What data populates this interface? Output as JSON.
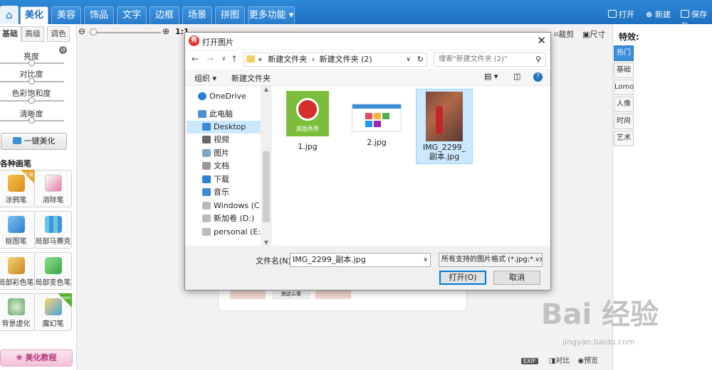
{
  "nav": {
    "home_icon": "home-icon",
    "tabs": [
      "美化",
      "美容",
      "饰品",
      "文字",
      "边框",
      "场景",
      "拼图",
      "更多功能"
    ],
    "right": {
      "open": "打开",
      "new": "新建",
      "save": "保存与"
    }
  },
  "left": {
    "tabs": [
      "基础",
      "高级",
      "调色"
    ],
    "sliders": [
      {
        "label": "亮度",
        "value": 0.5
      },
      {
        "label": "对比度",
        "value": 0.5
      },
      {
        "label": "色彩饱和度",
        "value": 0.5
      },
      {
        "label": "清晰度",
        "value": 0.5
      }
    ],
    "one_key": "一键美化",
    "section": "各种画笔",
    "tools": [
      "涂鸦笔",
      "消除笔",
      "抠图笔",
      "局部马赛克",
      "局部彩色笔",
      "局部变色笔",
      "背景虚化",
      "魔幻笔"
    ],
    "badge_upgrade": "升级",
    "badge_new": "new",
    "tutorial": "美化教程"
  },
  "zoom": {
    "ratio": "1:1"
  },
  "toolbar": {
    "crop": "裁剪",
    "size": "尺寸"
  },
  "right": {
    "title": "特效:",
    "tabs": [
      "热门",
      "基础",
      "Lomo",
      "人像",
      "时尚",
      "艺术"
    ]
  },
  "status": {
    "exif": "EXIF",
    "compare": "对比",
    "preview": "预览"
  },
  "frame_caption": "她这么看",
  "dialog": {
    "title": "打开图片",
    "path": [
      "«",
      "新建文件夹",
      "›",
      "新建文件夹 (2)"
    ],
    "search_placeholder": "搜索\"新建文件夹 (2)\"",
    "organize": "组织 ▾",
    "new_folder": "新建文件夹",
    "tree": [
      "OneDrive",
      "此电脑",
      "Desktop",
      "视频",
      "图片",
      "文档",
      "下载",
      "音乐",
      "Windows (C:)",
      "新加卷 (D:)",
      "personal (E:)"
    ],
    "files": [
      {
        "name": "1.jpg"
      },
      {
        "name": "2.jpg"
      },
      {
        "name": "IMG_2299_副本.jpg"
      }
    ],
    "thumb1_text": "美图秀秀",
    "filename_label": "文件名(N):",
    "filename_value": "IMG_2299_副本.jpg",
    "filetype": "所有支持的图片格式 (*.jpg;*.jp",
    "open": "打开(O)",
    "cancel": "取消"
  },
  "watermark": {
    "text": "Bai 经验",
    "sub": "jingyan.baidu.com"
  }
}
